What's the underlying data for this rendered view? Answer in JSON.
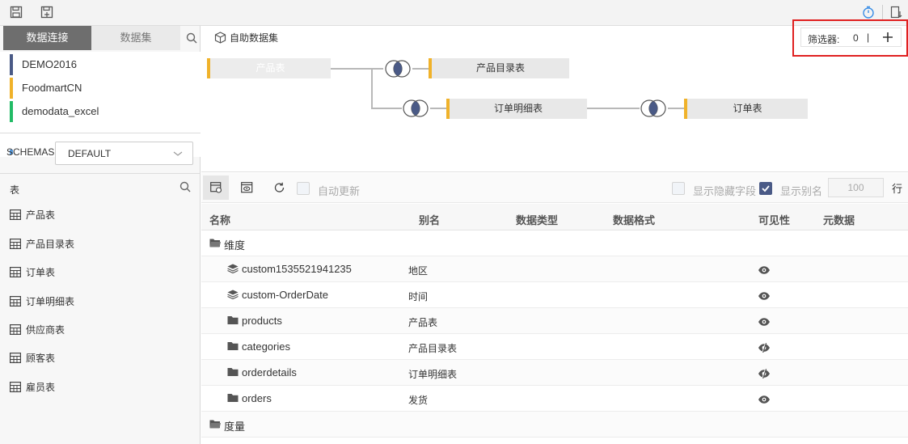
{
  "toolbar": {
    "icons": [
      "save-icon",
      "save-as-icon",
      "timer-icon",
      "export-icon"
    ]
  },
  "left_tabs": {
    "active": "数据连接",
    "inactive": "数据集"
  },
  "connections": [
    {
      "name": "DEMO2016",
      "color": "#4a5a86"
    },
    {
      "name": "FoodmartCN",
      "color": "#f0b22a"
    },
    {
      "name": "demodata_excel",
      "color": "#22bb66"
    }
  ],
  "schemas": {
    "label": "SCHEMAS",
    "value": "DEFAULT"
  },
  "tables_header": "表",
  "tables": [
    "产品表",
    "产品目录表",
    "订单表",
    "订单明细表",
    "供应商表",
    "顾客表",
    "雇员表"
  ],
  "diagram": {
    "title": "自助数据集",
    "filter": {
      "label": "筛选器:",
      "count": "0",
      "separator": "|"
    },
    "nodes": [
      "产品表",
      "产品目录表",
      "订单明细表",
      "订单表"
    ]
  },
  "grid_toolbar": {
    "auto_update": "自动更新",
    "show_hidden": "显示隐藏字段",
    "show_alias": "显示别名",
    "row_count": "100",
    "row_unit": "行"
  },
  "grid": {
    "headers": [
      "名称",
      "别名",
      "数据类型",
      "数据格式",
      "可见性",
      "元数据"
    ],
    "group_dimension": "维度",
    "group_measure": "度量",
    "rows": [
      {
        "name": "custom1535521941235",
        "alias": "地区",
        "icon": "layers-icon",
        "visibility": "visible"
      },
      {
        "name": "custom-OrderDate",
        "alias": "时间",
        "icon": "layers-icon",
        "visibility": "visible"
      },
      {
        "name": "products",
        "alias": "产品表",
        "icon": "folder-icon",
        "visibility": "visible"
      },
      {
        "name": "categories",
        "alias": "产品目录表",
        "icon": "folder-icon",
        "visibility": "hidden"
      },
      {
        "name": "orderdetails",
        "alias": "订单明细表",
        "icon": "folder-icon",
        "visibility": "hidden"
      },
      {
        "name": "orders",
        "alias": "发货",
        "icon": "folder-icon",
        "visibility": "visible"
      }
    ]
  }
}
